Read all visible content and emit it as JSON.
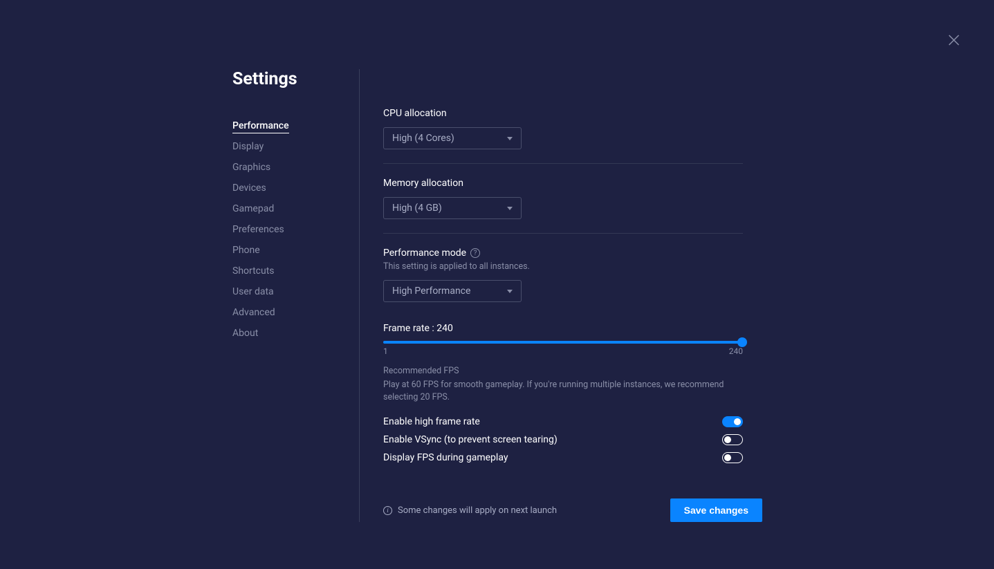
{
  "title": "Settings",
  "nav": {
    "items": [
      "Performance",
      "Display",
      "Graphics",
      "Devices",
      "Gamepad",
      "Preferences",
      "Phone",
      "Shortcuts",
      "User data",
      "Advanced",
      "About"
    ],
    "active_index": 0
  },
  "cpu": {
    "label": "CPU allocation",
    "value": "High (4 Cores)"
  },
  "memory": {
    "label": "Memory allocation",
    "value": "High (4 GB)"
  },
  "perfmode": {
    "label": "Performance mode",
    "sublabel": "This setting is applied to all instances.",
    "value": "High Performance"
  },
  "framerate": {
    "label": "Frame rate : 240",
    "value": 240,
    "min": "1",
    "max": "240",
    "rec_title": "Recommended FPS",
    "rec_text": "Play at 60 FPS for smooth gameplay. If you're running multiple instances, we recommend selecting 20 FPS."
  },
  "toggles": {
    "high_frame_rate": {
      "label": "Enable high frame rate",
      "on": true
    },
    "vsync": {
      "label": "Enable VSync (to prevent screen tearing)",
      "on": false
    },
    "display_fps": {
      "label": "Display FPS during gameplay",
      "on": false
    }
  },
  "footer": {
    "notice": "Some changes will apply on next launch",
    "save": "Save changes"
  }
}
